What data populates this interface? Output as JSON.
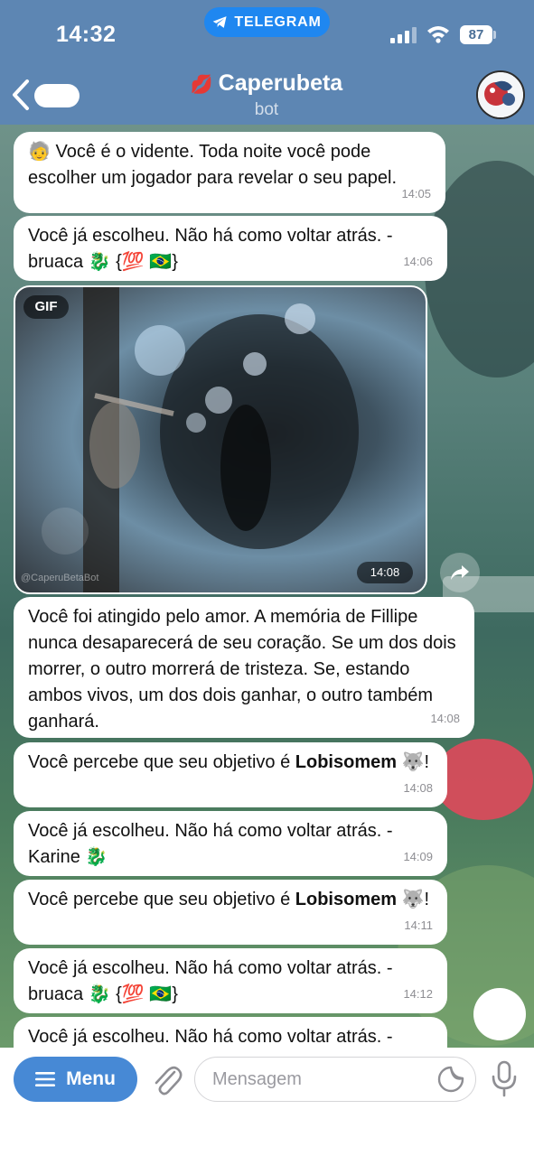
{
  "status_bar": {
    "time": "14:32",
    "app_pill": "TELEGRAM",
    "battery": "87"
  },
  "header": {
    "title": "Caperubeta",
    "subtitle": "bot",
    "title_emoji": "💋"
  },
  "messages": [
    {
      "text": "🧓 Você é o vidente. Toda noite você pode escolher um jogador para revelar o seu papel.",
      "time": "14:05"
    },
    {
      "text": "Você já escolheu. Não há como voltar atrás. - bruaca 🐉 {💯 🇧🇷}",
      "time": "14:06"
    },
    {
      "type": "gif",
      "badge": "GIF",
      "time": "14:08",
      "watermark": "@CaperuBetaBot"
    },
    {
      "text": "Você foi atingido pelo amor. A memória de Fillipe nunca desaparecerá de seu coração. Se um dos dois morrer, o outro morrerá de tristeza. Se, estando ambos vivos, um dos dois ganhar, o outro também ganhará.",
      "time": "14:08"
    },
    {
      "text_before": "Você percebe que seu objetivo é ",
      "bold": "Lobisomem",
      "text_after": " 🐺!",
      "time": "14:08"
    },
    {
      "text": "Você já escolheu. Não há como voltar atrás. - Karine 🐉",
      "time": "14:09"
    },
    {
      "text_before": "Você percebe que seu objetivo é ",
      "bold": "Lobisomem",
      "text_after": " 🐺!",
      "time": "14:11"
    },
    {
      "text": "Você já escolheu. Não há como voltar atrás. - bruaca 🐉 {💯 🇧🇷}",
      "time": "14:12"
    },
    {
      "text": "Você já escolheu. Não há como voltar atrás. -"
    }
  ],
  "input_bar": {
    "menu_label": "Menu",
    "placeholder": "Mensagem"
  },
  "colors": {
    "header": "#5d86b3",
    "telegram_pill": "#1f87f0",
    "menu_button": "#4789d5",
    "bubble": "#ffffff"
  },
  "icons": [
    "back-chevron-icon",
    "telegram-plane-icon",
    "signal-icon",
    "wifi-icon",
    "battery-icon",
    "share-icon",
    "hamburger-icon",
    "paperclip-icon",
    "sticker-icon",
    "microphone-icon"
  ]
}
